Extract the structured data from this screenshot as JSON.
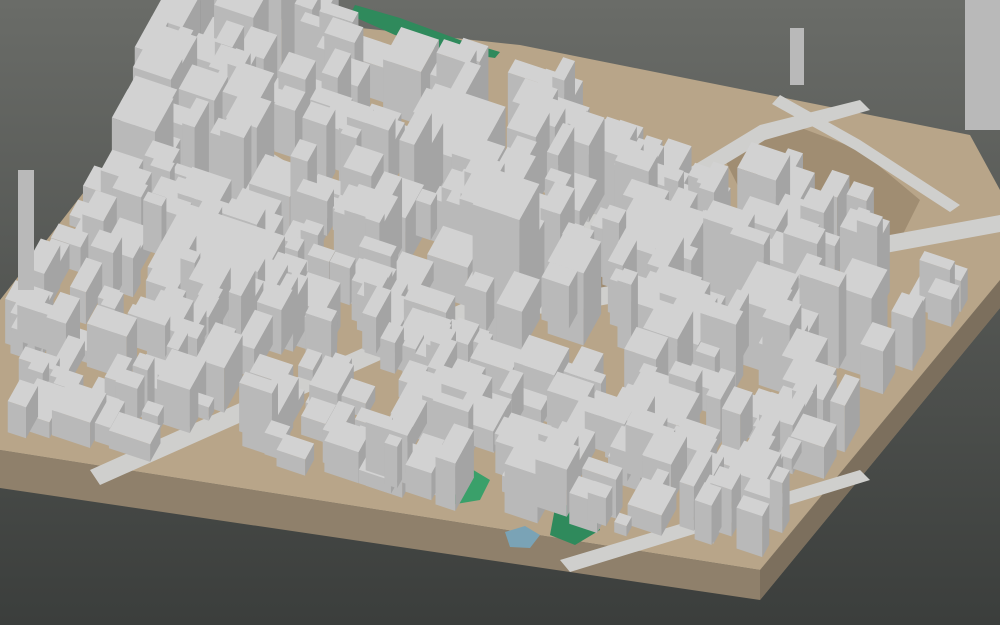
{
  "scene": {
    "subject": "3d-city-block-model",
    "colors": {
      "bg_top": "#6a6c68",
      "bg_bottom": "#3b3e3c",
      "base_side": "#8f806b",
      "base_side_dark": "#7c6f5d",
      "ground": "#b8a589",
      "ground_dark": "#a08d72",
      "road": "#cfcfcd",
      "building_top": "#d2d2d2",
      "building_left": "#b9b9b9",
      "building_right": "#a4a4a4",
      "vegetation": "#2f8a5c",
      "vegetation_light": "#3aa06a",
      "water": "#7aa3b6"
    }
  }
}
